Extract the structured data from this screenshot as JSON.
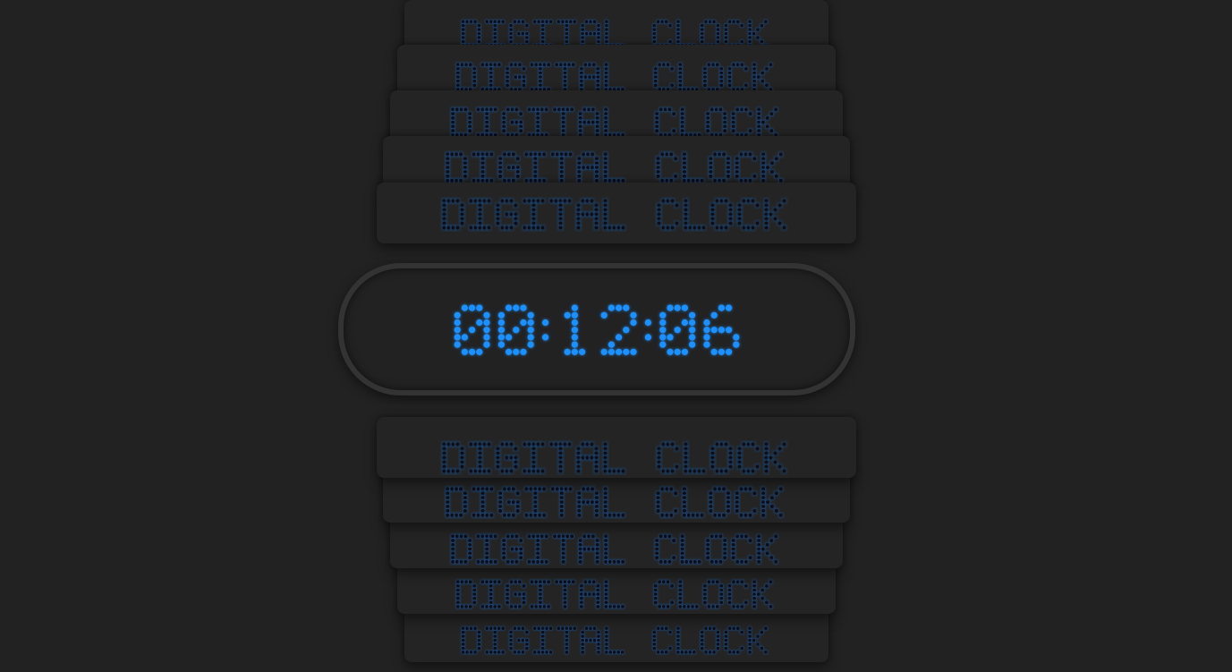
{
  "banner": {
    "text": "DIGITAL CLOCK",
    "dot_color": "#0a0f18",
    "glow_color": "#1e6fd9"
  },
  "clock": {
    "time": "00:12:06",
    "dot_color": "#1e90ff",
    "dim_dot_color": "#15181c"
  },
  "colors": {
    "background": "#222222",
    "frame": "#333333"
  }
}
